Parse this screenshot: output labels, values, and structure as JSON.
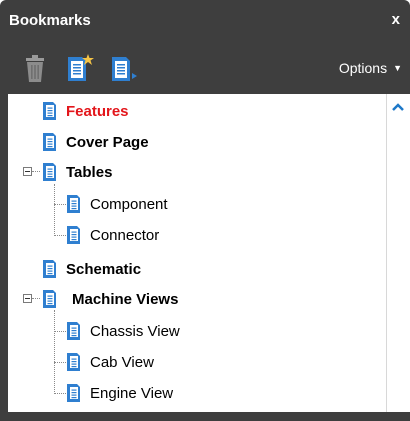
{
  "panel": {
    "title": "Bookmarks",
    "close_label": "x"
  },
  "toolbar": {
    "delete_icon": "trash-icon",
    "new_bookmark_icon": "new-bookmark-icon",
    "move_bookmark_icon": "move-bookmark-icon",
    "options_label": "Options"
  },
  "bookmarks": [
    {
      "label": "Features",
      "selected": true
    },
    {
      "label": "Cover Page"
    },
    {
      "label": "Tables",
      "expanded": true,
      "children": [
        {
          "label": "Component"
        },
        {
          "label": "Connector"
        }
      ]
    },
    {
      "label": "Schematic"
    },
    {
      "label": "Machine Views",
      "expanded": true,
      "children": [
        {
          "label": "Chassis View"
        },
        {
          "label": "Cab View"
        },
        {
          "label": "Engine View"
        }
      ]
    }
  ],
  "colors": {
    "panel_bg": "#3e3e3e",
    "selected_text": "#e3161b",
    "icon_blue": "#2f7fd0",
    "scroll_arrow": "#1e78c8"
  }
}
